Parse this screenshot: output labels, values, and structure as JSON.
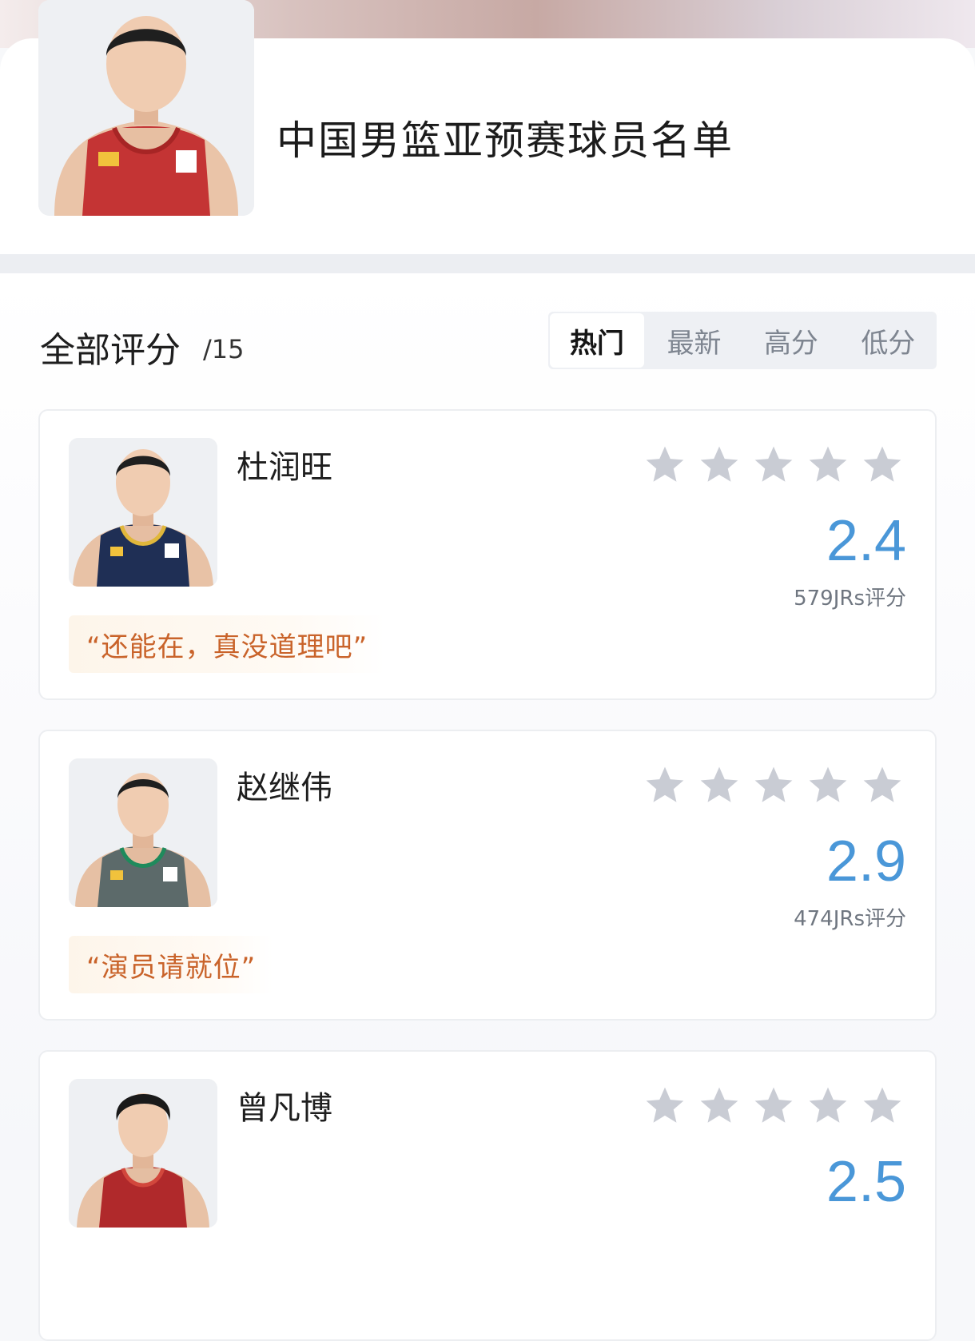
{
  "header": {
    "title": "中国男篮亚预赛球员名单"
  },
  "section": {
    "title": "全部评分",
    "count": "/15"
  },
  "tabs": [
    {
      "label": "热门",
      "active": true
    },
    {
      "label": "最新",
      "active": false
    },
    {
      "label": "高分",
      "active": false
    },
    {
      "label": "低分",
      "active": false
    }
  ],
  "players": [
    {
      "name": "杜润旺",
      "score": "2.4",
      "votes": "579JRs评分",
      "comment": "“还能在，真没道理吧”",
      "stars_filled": 0,
      "jersey_color": "#1f2f55",
      "trim_color": "#e0b73b"
    },
    {
      "name": "赵继伟",
      "score": "2.9",
      "votes": "474JRs评分",
      "comment": "“演员请就位”",
      "stars_filled": 0,
      "jersey_color": "#5c6a6a",
      "trim_color": "#1f8a5c"
    },
    {
      "name": "曾凡博",
      "score": "2.5",
      "stars_filled": 0,
      "jersey_color": "#b0292b",
      "trim_color": "#d2473c"
    }
  ],
  "colors": {
    "score": "#4a97d8",
    "star_empty": "#c9ccd4",
    "comment_text": "#c9632a"
  },
  "icons": {
    "star": "star-icon"
  }
}
